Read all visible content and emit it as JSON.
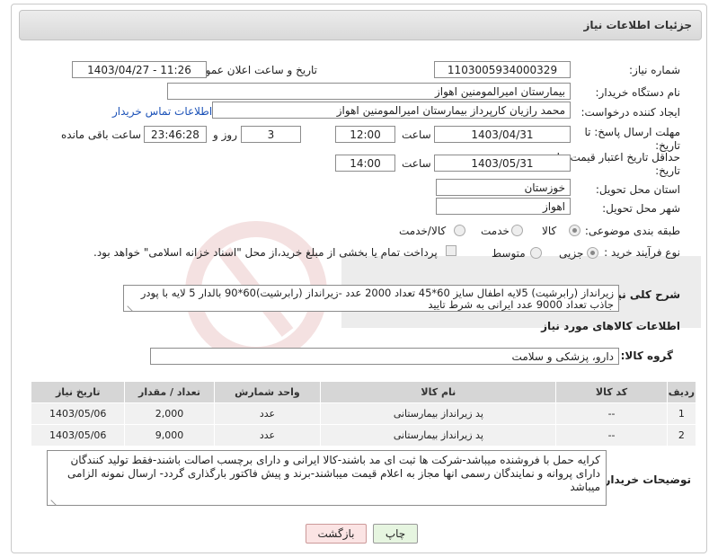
{
  "header": {
    "title": "جزئیات اطلاعات نیاز"
  },
  "fields": {
    "need_number_label": "شماره نیاز:",
    "need_number": "1103005934000329",
    "announce_label": "تاریخ و ساعت اعلان عمومی:",
    "announce_value": "1403/04/27 - 11:26",
    "buyer_label": "نام دستگاه خریدار:",
    "buyer": "بیمارستان امیرالمومنین اهواز",
    "creator_label": "ایجاد کننده درخواست:",
    "creator": "محمد رازیان کارپرداز بیمارستان امیرالمومنین اهواز",
    "contact_link": "اطلاعات تماس خریدار",
    "deadline_label": "مهلت ارسال پاسخ: تا تاریخ:",
    "deadline_date": "1403/04/31",
    "time_label": "ساعت",
    "deadline_time": "12:00",
    "days_value": "3",
    "days_label": "روز و",
    "remaining_time": "23:46:28",
    "remaining_label": "ساعت باقی مانده",
    "validity_label": "حداقل تاریخ اعتبار قیمت: تا تاریخ:",
    "validity_date": "1403/05/31",
    "validity_time": "14:00",
    "province_label": "استان محل تحویل:",
    "province": "خوزستان",
    "city_label": "شهر محل تحویل:",
    "city": "اهواز",
    "category_label": "طبقه بندی موضوعی:",
    "category_options": [
      "کالا",
      "خدمت",
      "کالا/خدمت"
    ],
    "purchase_label": "نوع فرآیند خرید :",
    "purchase_options": [
      "جزیی",
      "متوسط"
    ],
    "purchase_note": "پرداخت تمام یا بخشی از مبلغ خرید،از محل \"اسناد خزانه اسلامی\" خواهد بود."
  },
  "description": {
    "label": "شرح کلی نیاز:",
    "text": "زیرانداز (رابرشیت) 5لایه اطفال سایز 60*45 تعداد 2000 عدد -زیرانداز (رابرشیت)60*90 بالدار 5 لایه با پودر جاذب تعداد 9000 عدد ایرانی به شرط تایید"
  },
  "goods": {
    "section_title": "اطلاعات کالاهای مورد نیاز",
    "group_label": "گروه کالا:",
    "group_value": "دارو، پزشکی و سلامت",
    "columns": [
      "ردیف",
      "کد کالا",
      "نام کالا",
      "واحد شمارش",
      "تعداد / مقدار",
      "تاریخ نیاز"
    ],
    "rows": [
      [
        "1",
        "--",
        "پد زیرانداز بیمارستانی",
        "عدد",
        "2,000",
        "1403/05/06"
      ],
      [
        "2",
        "--",
        "پد زیرانداز بیمارستانی",
        "عدد",
        "9,000",
        "1403/05/06"
      ]
    ]
  },
  "notes": {
    "label": "توضیحات خریدار:",
    "text": "کرایه حمل با فروشنده میباشد-شرکت ها ثبت ای مد باشند-کالا ایرانی و دارای برچسب اصالت باشند-فقط تولید کنندگان دارای پروانه و نمایندگان رسمی انها مجاز به اعلام قیمت میباشند-برند و پیش فاکتور بارگذاری گردد- ارسال نمونه الزامی میباشد"
  },
  "buttons": {
    "print": "چاپ",
    "back": "بازگشت"
  },
  "colors": {
    "header_bg": "#dcdcdc",
    "link": "#1c52b8",
    "print_btn": "#e6f5e0",
    "back_btn": "#fbe4e4"
  }
}
